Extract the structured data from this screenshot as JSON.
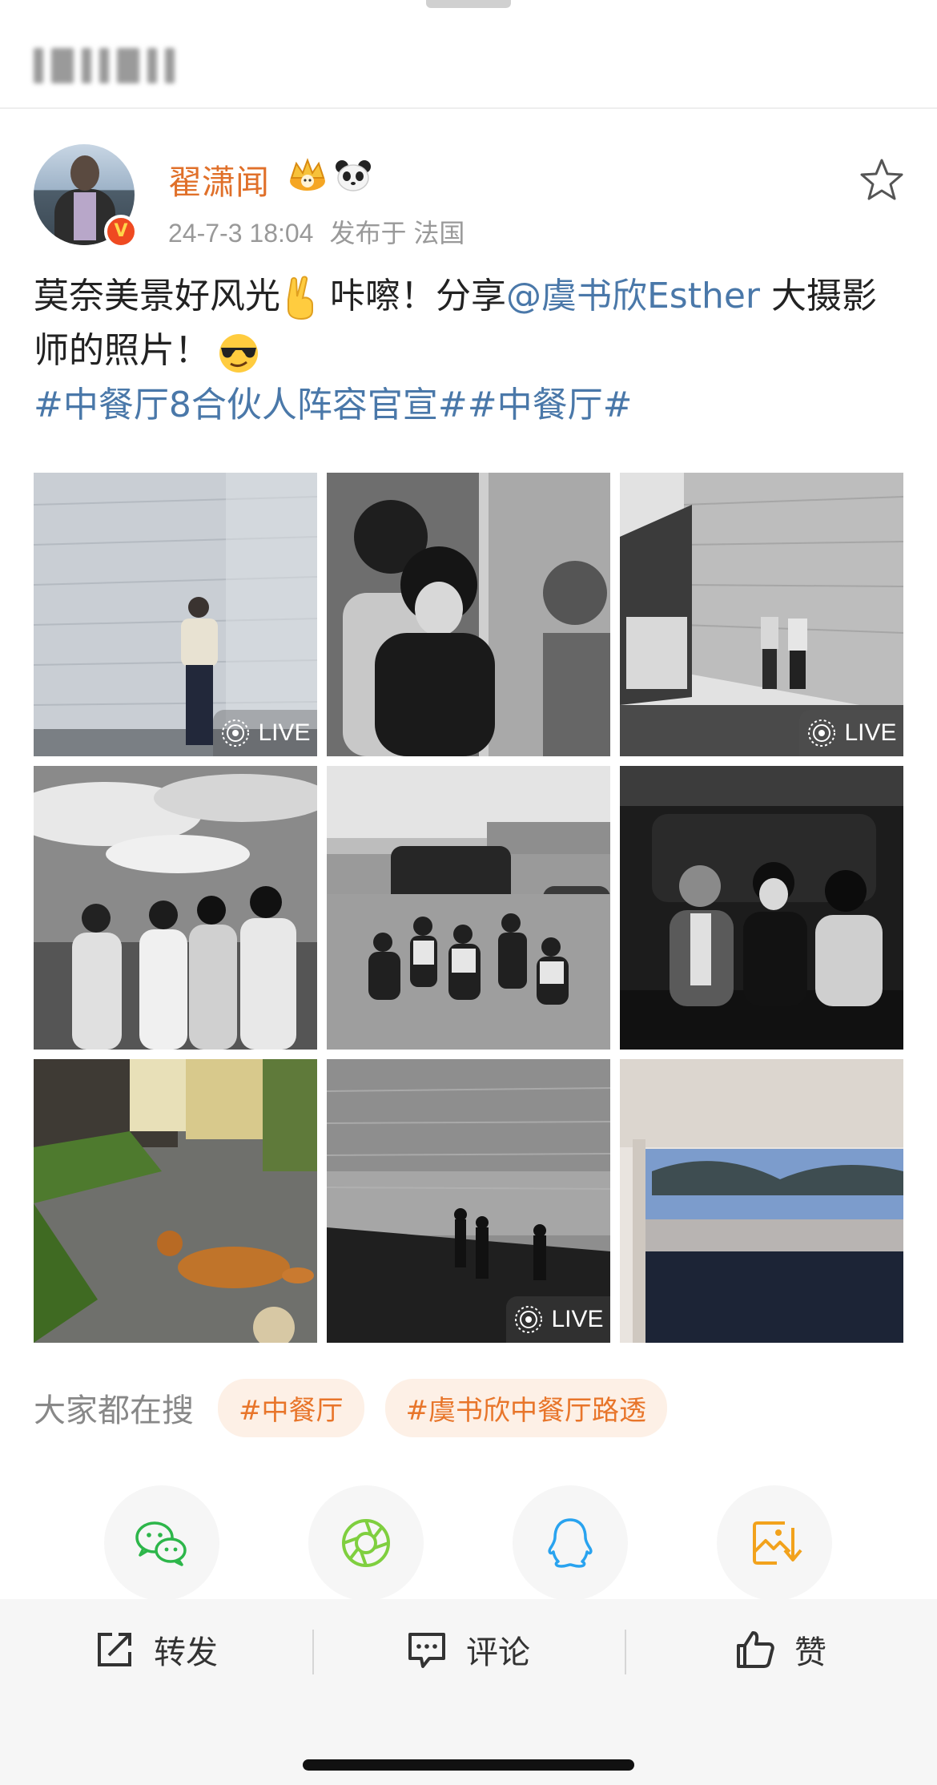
{
  "post": {
    "author": "翟潇闻",
    "time": "24-7-3 18:04",
    "location_label": "发布于 法国",
    "text_before": "莫奈美景好风光",
    "text_after_emoji": " 咔嚓！分享",
    "mention": "@虞书欣Esther",
    "text_tail": " 大摄影师的照片！",
    "hashtags": "#中餐厅8合伙人阵容官宣##中餐厅#"
  },
  "photos": {
    "live_label": "LIVE",
    "items": [
      {
        "name": "photo-man-at-wall",
        "live": true
      },
      {
        "name": "photo-two-men-bw",
        "live": false
      },
      {
        "name": "photo-two-men-store",
        "live": true
      },
      {
        "name": "photo-four-men-clouds",
        "live": false
      },
      {
        "name": "photo-group-by-van",
        "live": false
      },
      {
        "name": "photo-three-in-trunk",
        "live": false
      },
      {
        "name": "photo-dog-on-path",
        "live": false
      },
      {
        "name": "photo-sea-shore",
        "live": true
      },
      {
        "name": "photo-window-trees",
        "live": false
      }
    ]
  },
  "hot_search": {
    "label": "大家都在搜",
    "tags": [
      "#中餐厅",
      "#虞书欣中餐厅路透"
    ]
  },
  "share_icons": [
    "wechat-icon",
    "moments-icon",
    "qq-icon",
    "save-image-icon"
  ],
  "actions": {
    "repost": "转发",
    "comment": "评论",
    "like": "赞"
  },
  "colors": {
    "name_orange": "#e0702a",
    "link_blue": "#4a78a9",
    "tag_bg": "#fdf0e6",
    "tag_text": "#e8752a"
  }
}
